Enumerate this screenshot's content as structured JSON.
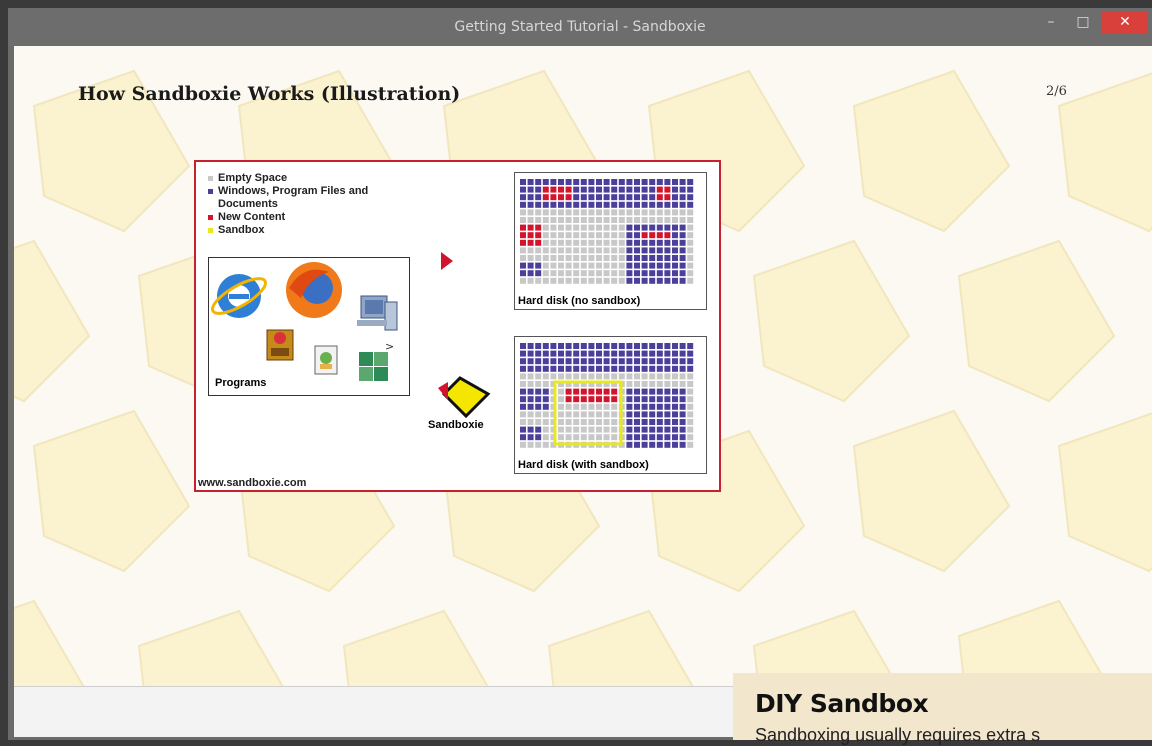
{
  "window": {
    "title": "Getting Started Tutorial - Sandboxie",
    "minimize_symbol": "–",
    "maximize_symbol": "□",
    "close_symbol": "✕"
  },
  "slide": {
    "heading": "How Sandboxie Works (Illustration)",
    "page_indicator": "2/6"
  },
  "illustration": {
    "legend": [
      {
        "label": "Empty Space",
        "color": "#c8c8c8"
      },
      {
        "label": "Windows, Program Files and Documents",
        "color": "#4a3f9a"
      },
      {
        "label": "New Content",
        "color": "#d1152c"
      },
      {
        "label": "Sandbox",
        "color": "#e8e820"
      }
    ],
    "programs_label": "Programs",
    "program_icons": [
      "internet-explorer-icon",
      "firefox-icon",
      "computer-icon",
      "application-icon",
      "document-icon",
      "puzzle-icon"
    ],
    "sandboxie_label": "Sandboxie",
    "disk_no_sandbox_label": "Hard disk (no sandbox)",
    "disk_with_sandbox_label": "Hard disk (with sandbox)",
    "url": "www.sandboxie.com",
    "colors": {
      "border": "#c9202f",
      "empty": "#c8c8c8",
      "system": "#4a3f9a",
      "new": "#d1152c",
      "sandbox": "#e8e820"
    }
  },
  "sidebar_article": {
    "title": "DIY Sandbox",
    "text": "Sandboxing usually requires extra s"
  }
}
